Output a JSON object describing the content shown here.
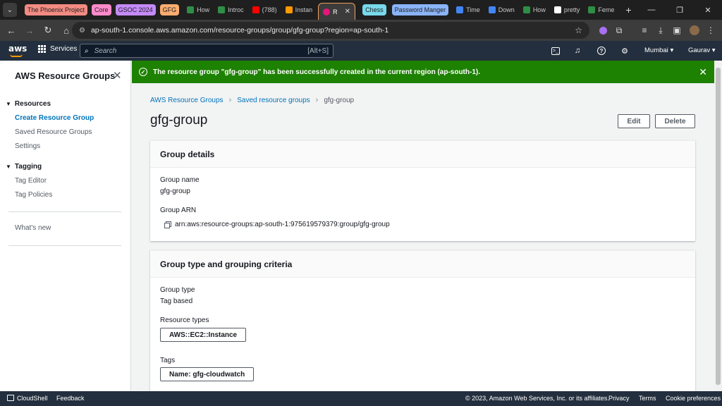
{
  "browser": {
    "tab_groups": [
      {
        "label": "The Phoenix Project",
        "color": "#f28b82"
      },
      {
        "label": "Core",
        "color": "#ff8bcb"
      },
      {
        "label": "GSOC 2024",
        "color": "#c58af9"
      },
      {
        "label": "GFG",
        "color": "#fcad70"
      }
    ],
    "tabs_before": [
      {
        "label": "How",
        "fav_color": "#2f8d46"
      },
      {
        "label": "Introc",
        "fav_color": "#2f8d46"
      },
      {
        "label": "(788)",
        "fav_color": "#ff0000"
      },
      {
        "label": "Instan",
        "fav_color": "#ff9900"
      }
    ],
    "active_tab": {
      "label": "R",
      "fav_color": "#e7157b"
    },
    "chess_chip": {
      "label": "Chess",
      "color": "#78d9ec"
    },
    "pw_chip": {
      "label": "Password Manger",
      "color": "#8ab4f8"
    },
    "tabs_after": [
      {
        "label": "Time",
        "fav_color": "#4285f4"
      },
      {
        "label": "Down",
        "fav_color": "#4285f4"
      },
      {
        "label": "How",
        "fav_color": "#2f8d46"
      },
      {
        "label": "pretty",
        "fav_color": "#ffffff"
      },
      {
        "label": "Feme",
        "fav_color": "#2f8d46"
      }
    ],
    "url": "ap-south-1.console.aws.amazon.com/resource-groups/group/gfg-group?region=ap-south-1"
  },
  "awsnav": {
    "logo": "aws",
    "services_label": "Services",
    "search_placeholder": "Search",
    "search_shortcut": "[Alt+S]",
    "region": "Mumbai",
    "user": "Gaurav"
  },
  "sidebar": {
    "title": "AWS Resource Groups",
    "resources_section": "Resources",
    "resources_items": [
      "Create Resource Group",
      "Saved Resource Groups",
      "Settings"
    ],
    "tagging_section": "Tagging",
    "tagging_items": [
      "Tag Editor",
      "Tag Policies"
    ],
    "whats_new": "What's new"
  },
  "flash": {
    "message": "The resource group \"gfg-group\" has been successfully created in the current region (ap-south-1).",
    "color": "#1d8102"
  },
  "breadcrumb": [
    "AWS Resource Groups",
    "Saved resource groups",
    "gfg-group"
  ],
  "page": {
    "title": "gfg-group",
    "edit_label": "Edit",
    "delete_label": "Delete"
  },
  "details": {
    "header": "Group details",
    "name_label": "Group name",
    "name_value": "gfg-group",
    "arn_label": "Group ARN",
    "arn_value": "arn:aws:resource-groups:ap-south-1:975619579379:group/gfg-group"
  },
  "criteria": {
    "header": "Group type and grouping criteria",
    "type_label": "Group type",
    "type_value": "Tag based",
    "resource_types_label": "Resource types",
    "resource_type_token": "AWS::EC2::Instance",
    "tags_label": "Tags",
    "tag_token": "Name: gfg-cloudwatch"
  },
  "footer": {
    "cloudshell": "CloudShell",
    "feedback": "Feedback",
    "copyright": "© 2023, Amazon Web Services, Inc. or its affiliates.",
    "privacy": "Privacy",
    "terms": "Terms",
    "cookies": "Cookie preferences"
  }
}
